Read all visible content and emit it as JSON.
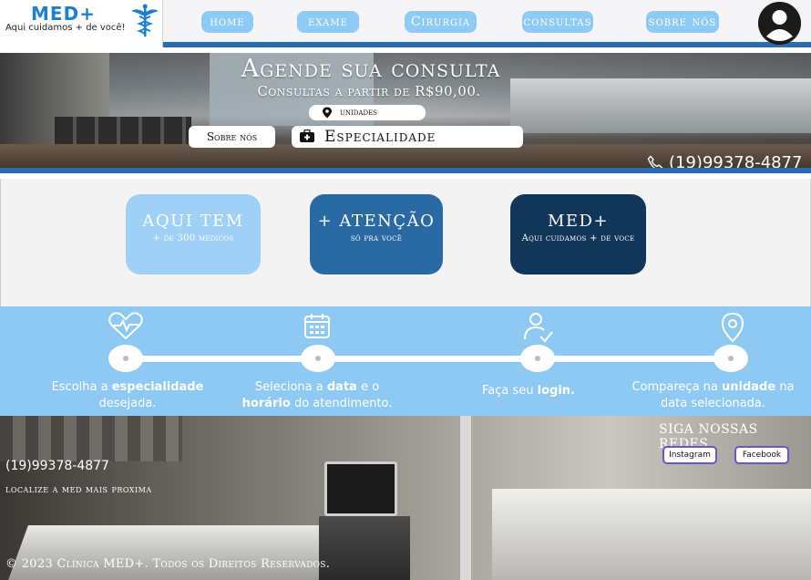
{
  "header": {
    "logo_title": "MED+",
    "logo_subtitle": "Aqui cuidamos + de você!",
    "nav": [
      {
        "label": "home"
      },
      {
        "label": "exame"
      },
      {
        "label": "Cirurgia"
      },
      {
        "label": "consultas"
      },
      {
        "label": "sobre nós"
      }
    ]
  },
  "hero": {
    "title": "Agende sua consulta",
    "subtitle": "Consultas a partir de R$90,00.",
    "unidades_label": "unidades",
    "sobre_label": "Sobre nós",
    "especialidade_label": "Especialidade",
    "phone": "(19)99378-4877"
  },
  "cards": [
    {
      "title": "AQUI TEM",
      "subtitle": "+ de 300 médicos",
      "color": "#9fd0f5"
    },
    {
      "title": "+ ATENÇÃO",
      "subtitle": "só pra você",
      "color": "#2a6aa4"
    },
    {
      "title": "MED+",
      "subtitle": "Aqui cuidamos + de voce",
      "color": "#12365a"
    }
  ],
  "steps": [
    {
      "icon": "heart-pulse-icon",
      "pre": "Escolha a ",
      "bold": "especialidade",
      "post": " desejada.",
      "line2_bold": "",
      "line2_post": ""
    },
    {
      "icon": "calendar-icon",
      "pre": "Seleciona a ",
      "bold": "data",
      "post": " e o",
      "line2_bold": "horário",
      "line2_post": " do atendimento."
    },
    {
      "icon": "user-check-icon",
      "pre": "Faça seu ",
      "bold": "login.",
      "post": "",
      "line2_bold": "",
      "line2_post": ""
    },
    {
      "icon": "location-pin-icon",
      "pre": "Compareça na ",
      "bold": "unidade",
      "post": " na",
      "line2_bold": "",
      "line2_post": "data selecionada."
    }
  ],
  "footer": {
    "social_heading": "SIGA NOSSAS REDES",
    "social": [
      {
        "label": "Instagram"
      },
      {
        "label": "Facebook"
      }
    ],
    "phone": "(19)99378-4877",
    "locate": "localize a med mais proxima",
    "copyright": "© 2023 Clínica MED+. Todos os Direitos Reservados."
  },
  "colors": {
    "accent": "#2b6cae",
    "light_blue": "#8ec9f4",
    "nav_pill": "#8ecbf4"
  }
}
